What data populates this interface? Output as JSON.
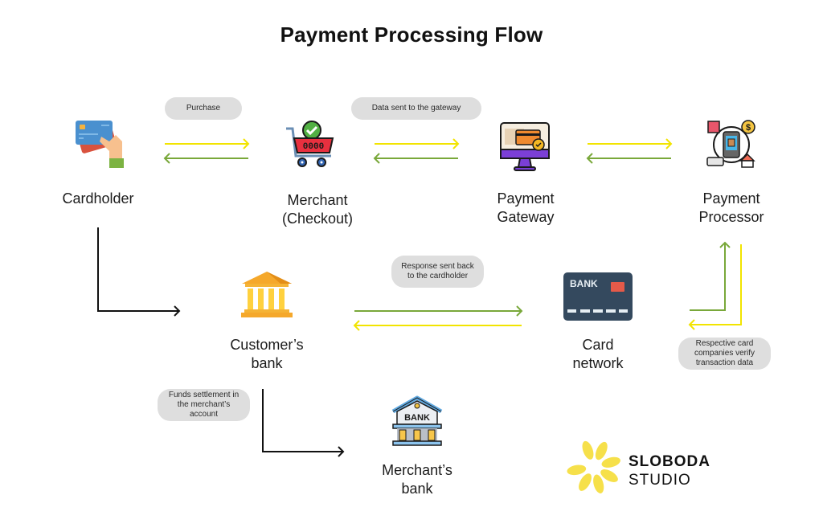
{
  "title": "Payment Processing Flow",
  "colors": {
    "forward_arrow": "#f2e400",
    "return_arrow": "#79a83a",
    "neutral_arrow": "#111111",
    "pill_background": "#dedede",
    "logo_yellow": "#f6e04a"
  },
  "nodes": {
    "cardholder": {
      "label": "Cardholder",
      "icon": "credit-cards-in-hand-icon"
    },
    "merchant": {
      "label_line1": "Merchant",
      "label_line2": "(Checkout)",
      "icon": "shopping-cart-check-icon"
    },
    "gateway": {
      "label_line1": "Payment",
      "label_line2": "Gateway",
      "icon": "monitor-card-payment-icon"
    },
    "processor": {
      "label_line1": "Payment",
      "label_line2": "Processor",
      "icon": "mobile-payment-processing-icon"
    },
    "customer_bank": {
      "label_line1": "Customer’s",
      "label_line2": "bank",
      "icon": "bank-building-icon"
    },
    "card_network": {
      "label_line1": "Card",
      "label_line2": "network",
      "icon": "bank-card-icon",
      "card_text": "BANK"
    },
    "merchant_bank": {
      "label_line1": "Merchant’s",
      "label_line2": "bank",
      "icon": "bank-building-sign-icon",
      "sign_text": "BANK"
    }
  },
  "steps": {
    "purchase": "Purchase",
    "data_to_gateway": "Data sent to the gateway",
    "response_line1": "Response sent back",
    "response_line2": "to the cardholder",
    "verify_line1": "Respective card",
    "verify_line2": "companies verify",
    "verify_line3": "transaction data",
    "settlement_line1": "Funds settlement in",
    "settlement_line2": "the merchant’s",
    "settlement_line3": "account"
  },
  "logo": {
    "line1": "SLOBODA",
    "line2": "STUDIO"
  }
}
